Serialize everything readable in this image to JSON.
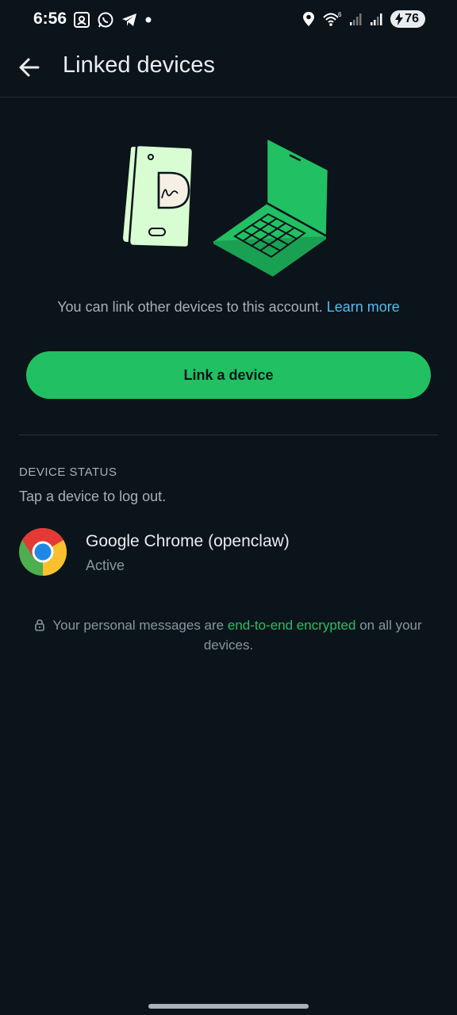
{
  "status_bar": {
    "time": "6:56",
    "battery": "76",
    "icons_left": [
      "screenshot-icon",
      "whatsapp-icon",
      "telegram-icon",
      "dot-icon"
    ],
    "icons_right": [
      "location-icon",
      "wifi-icon",
      "signal-icon",
      "signal-icon",
      "battery-charging-icon"
    ]
  },
  "app_bar": {
    "title": "Linked devices",
    "back_icon": "arrow-left-icon"
  },
  "intro": {
    "text": "You can link other devices to this account.",
    "learn_more": "Learn more"
  },
  "link_button": "Link a device",
  "device_status": {
    "heading": "DEVICE STATUS",
    "subtext": "Tap a device to log out.",
    "devices": [
      {
        "name": "Google Chrome (openclaw)",
        "status": "Active",
        "icon": "chrome-icon"
      }
    ]
  },
  "encryption": {
    "prefix": "Your personal messages are",
    "link": "end-to-end encrypted",
    "suffix": "on all your devices."
  },
  "colors": {
    "background": "#0b141a",
    "accent": "#21c063",
    "link": "#53bdeb",
    "text_primary": "#e9edef",
    "text_secondary": "#8696a0"
  }
}
